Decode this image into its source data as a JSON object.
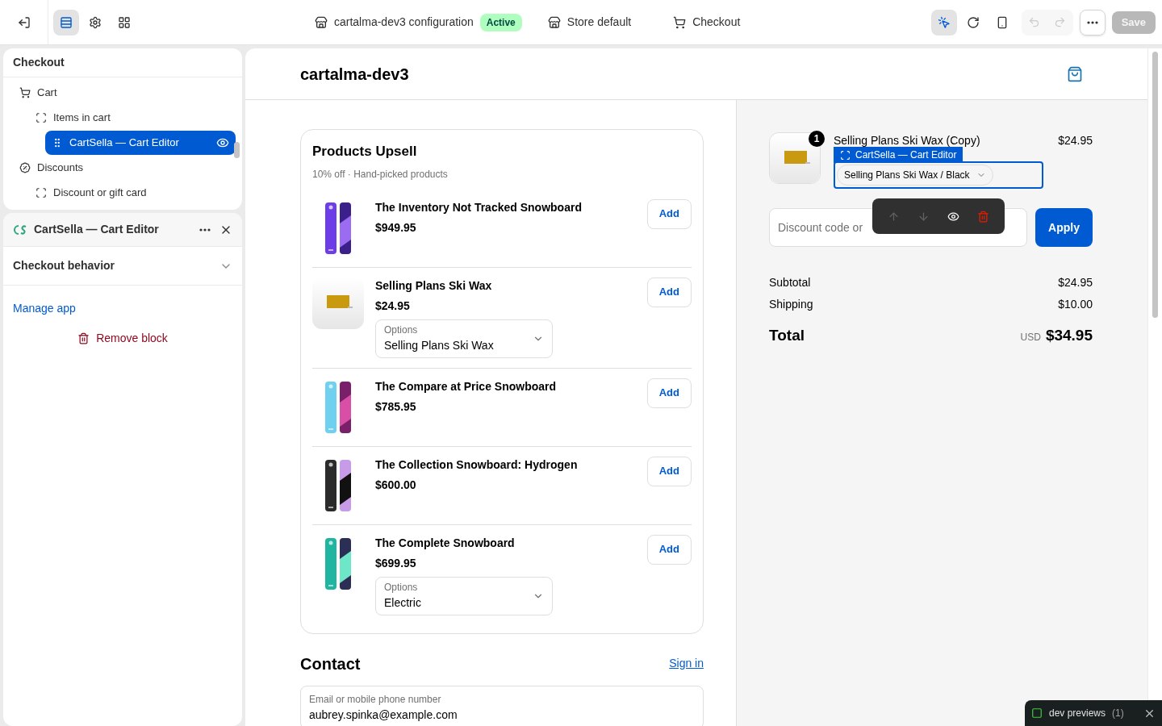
{
  "top_bar": {
    "left_tools": [
      {
        "kind": "sections",
        "selected": true
      },
      {
        "kind": "settings",
        "selected": false
      },
      {
        "kind": "apps",
        "selected": false
      }
    ],
    "configuration": "cartalma-dev3 configuration",
    "status": "Active",
    "store": "Store default",
    "page": "Checkout",
    "right_tools": [
      {
        "kind": "inspector",
        "selected": true
      },
      {
        "kind": "refresh",
        "selected": false
      },
      {
        "kind": "mobile",
        "selected": false
      }
    ],
    "undo_disabled": true,
    "redo_disabled": true,
    "save": {
      "label": "Save",
      "disabled": true
    }
  },
  "outline": {
    "title": "Checkout",
    "items": [
      {
        "label": "Cart",
        "selected": false,
        "children": [
          {
            "label": "Items in cart",
            "selected": false,
            "children": [
              {
                "label": "CartSella — Cart Editor",
                "selected": true
              }
            ]
          }
        ]
      },
      {
        "label": "Discounts",
        "selected": false,
        "children": [
          {
            "label": "Discount or gift card",
            "selected": false
          }
        ]
      }
    ]
  },
  "block_panel": {
    "title": "CartSella — Cart Editor",
    "section": "Checkout behavior",
    "expanded": false,
    "link": "Manage app",
    "remove": "Remove block"
  },
  "shop": {
    "name": "cartalma-dev3"
  },
  "upsell": {
    "title": "Products Upsell",
    "subtitle": "10% off · Hand-picked products",
    "products": [
      {
        "name": "The Inventory Not Tracked Snowboard",
        "price": "$949.95",
        "button": "Add"
      },
      {
        "name": "Selling Plans Ski Wax",
        "price": "$24.95",
        "button": "Add",
        "options_label": "Options",
        "option": "Selling Plans Ski Wax"
      },
      {
        "name": "The Compare at Price Snowboard",
        "price": "$785.95",
        "button": "Add"
      },
      {
        "name": "The Collection Snowboard: Hydrogen",
        "price": "$600.00",
        "button": "Add"
      },
      {
        "name": "The Complete Snowboard",
        "price": "$699.95",
        "button": "Add",
        "options_label": "Options",
        "option": "Electric"
      }
    ]
  },
  "contact": {
    "title": "Contact",
    "sign_in": "Sign in",
    "field_label": "Email or mobile phone number",
    "value": "aubrey.spinka@example.com"
  },
  "order": {
    "quantity": "1",
    "name": "Selling Plans Ski Wax (Copy)",
    "price": "$24.95",
    "block_label": "CartSella — Cart Editor",
    "variant": "Selling Plans Ski Wax / Black",
    "discount_placeholder": "Discount code or",
    "apply": "Apply",
    "lines": [
      {
        "label": "Subtotal",
        "value": "$24.95"
      },
      {
        "label": "Shipping",
        "value": "$10.00"
      }
    ],
    "total_label": "Total",
    "currency": "USD",
    "total": "$34.95"
  },
  "block_toolbar": [
    {
      "kind": "up",
      "disabled": true
    },
    {
      "kind": "down",
      "disabled": true
    },
    {
      "kind": "eye",
      "disabled": false
    },
    {
      "kind": "trash",
      "disabled": false
    }
  ],
  "dev_toast": {
    "label": "dev previews",
    "count": "(1)"
  }
}
